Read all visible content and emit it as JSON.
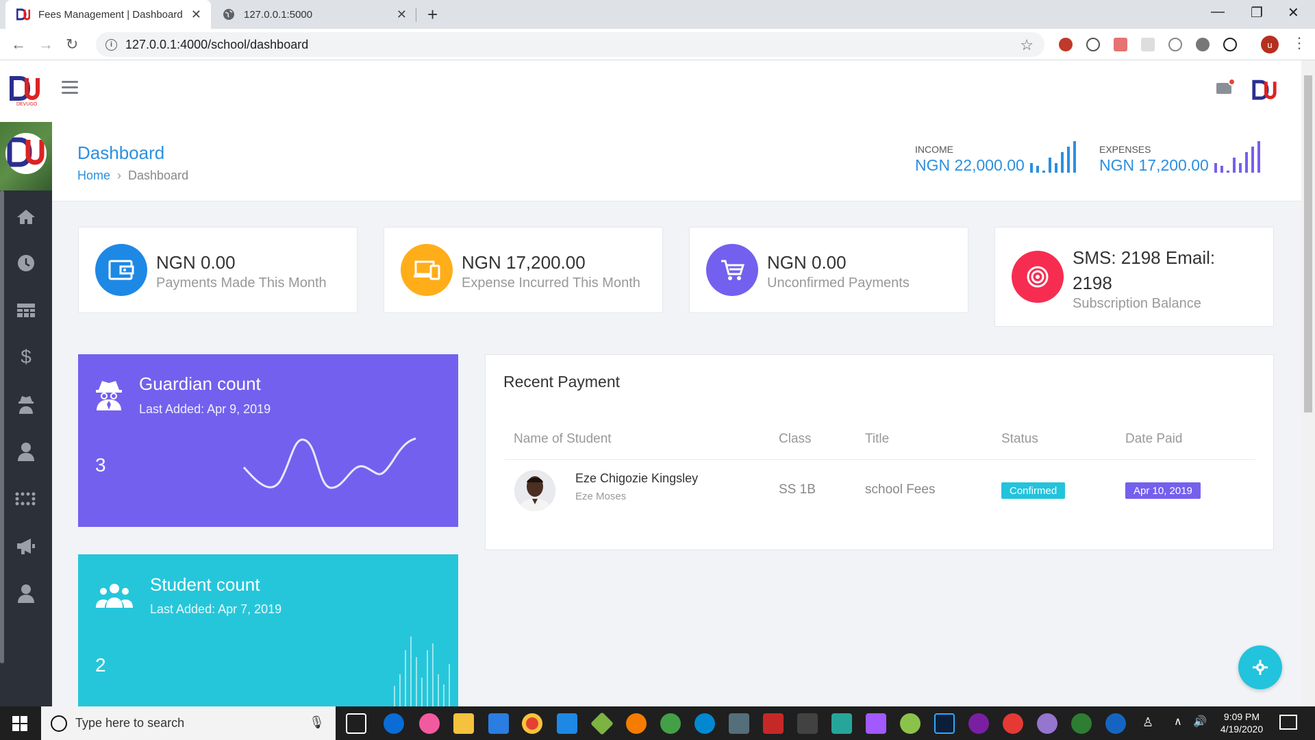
{
  "browser": {
    "tabs": [
      {
        "title": "Fees Management | Dashboard",
        "active": true
      },
      {
        "title": "127.0.0.1:5000",
        "active": false
      }
    ],
    "url": "127.0.0.1:4000/school/dashboard",
    "profile_initial": "u"
  },
  "header": {
    "page_title": "Dashboard",
    "breadcrumb": {
      "home": "Home",
      "current": "Dashboard"
    },
    "income": {
      "label": "INCOME",
      "value": "NGN 22,000.00"
    },
    "expenses": {
      "label": "EXPENSES",
      "value": "NGN 17,200.00"
    }
  },
  "cards": [
    {
      "amount": "NGN 0.00",
      "desc": "Payments Made This Month",
      "color": "#1e88e5",
      "icon": "wallet-icon"
    },
    {
      "amount": "NGN 17,200.00",
      "desc": "Expense Incurred This Month",
      "color": "#ffae1a",
      "icon": "devices-icon"
    },
    {
      "amount": "NGN 0.00",
      "desc": "Unconfirmed Payments",
      "color": "#7460ee",
      "icon": "cart-icon"
    },
    {
      "amount": "SMS: 2198 Email: 2198",
      "desc": "Subscription Balance",
      "color": "#f62d51",
      "icon": "target-icon"
    }
  ],
  "counts": {
    "guardian": {
      "title": "Guardian count",
      "last_added": "Last Added: Apr 9, 2019",
      "count": "3",
      "color": "#7460ee"
    },
    "student": {
      "title": "Student count",
      "last_added": "Last Added: Apr 7, 2019",
      "count": "2",
      "color": "#26c6da"
    }
  },
  "recent_payment": {
    "title": "Recent Payment",
    "columns": [
      "Name of Student",
      "Class",
      "Title",
      "Status",
      "Date Paid"
    ],
    "rows": [
      {
        "student": "Eze Chigozie Kingsley",
        "parent": "Eze Moses",
        "class": "SS 1B",
        "title": "school Fees",
        "status": "Confirmed",
        "date": "Apr 10, 2019"
      }
    ]
  },
  "taskbar": {
    "search_placeholder": "Type here to search",
    "time": "9:09 PM",
    "date": "4/19/2020"
  },
  "colors": {
    "accent": "#2b8fe0",
    "sidebar": "#2c3038",
    "success": "#22c3dc",
    "date_badge": "#7460ee"
  }
}
